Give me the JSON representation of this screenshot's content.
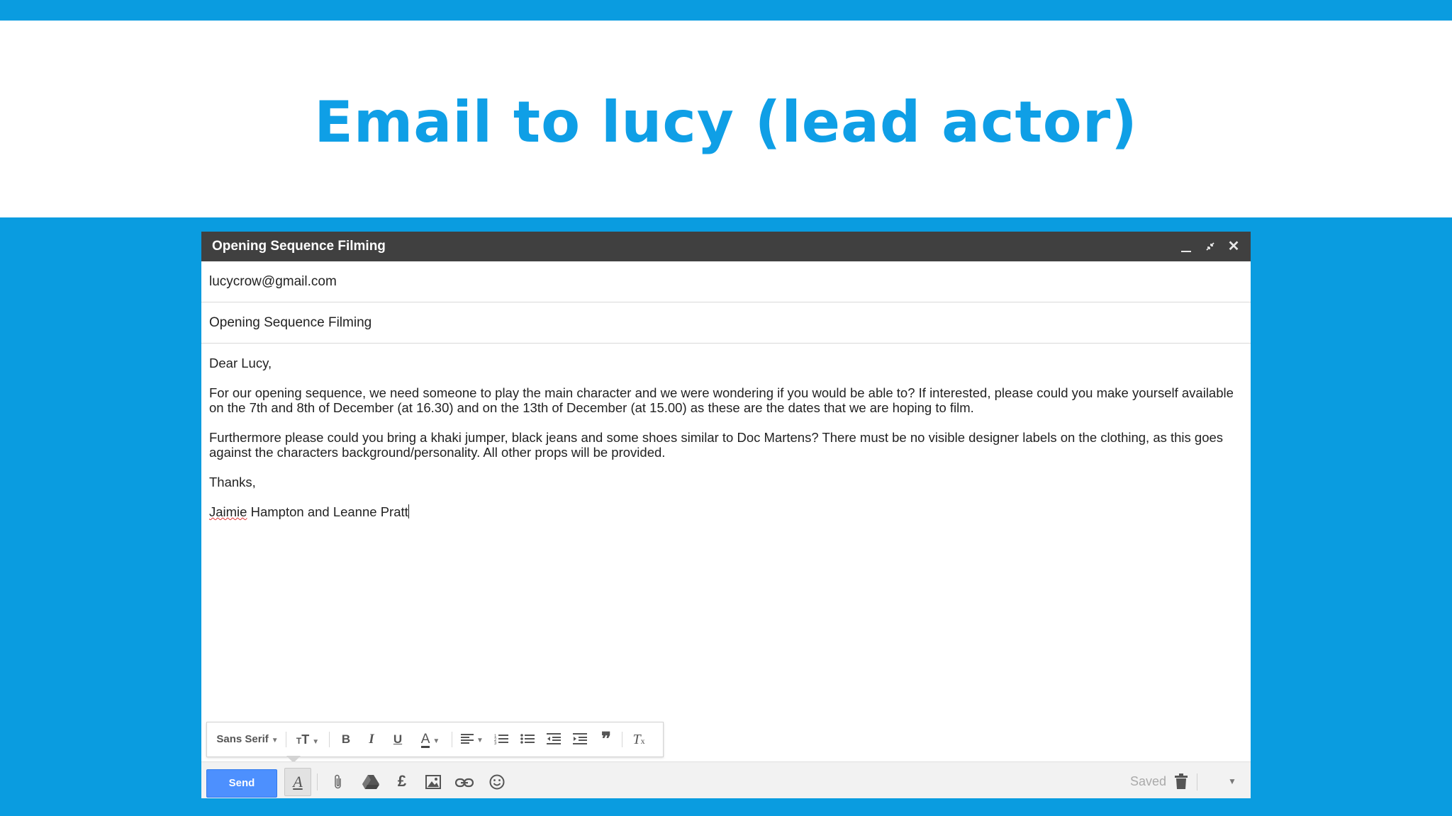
{
  "slide": {
    "title": "Email to lucy (lead actor)"
  },
  "compose": {
    "window_title": "Opening Sequence Filming",
    "to": "lucycrow@gmail.com",
    "subject": "Opening Sequence Filming",
    "body": {
      "greeting": "Dear Lucy,",
      "paragraph1": "For our opening sequence, we need someone to play the main character and we were wondering if you would be able to? If interested, please could you make yourself available on the 7th and 8th of December (at 16.30) and on the 13th of December (at 15.00) as these are the dates that we are hoping to film.",
      "paragraph2": "Furthermore please could you bring a khaki jumper, black jeans and some shoes similar to Doc Martens? There must be no visible designer labels on the clothing, as this goes against the characters background/personality. All other props will be provided.",
      "closing": "Thanks,",
      "signature_first": "Jaimie",
      "signature_rest": " Hampton and Leanne Pratt"
    },
    "format_bar": {
      "font": "Sans Serif"
    },
    "bottom": {
      "send_label": "Send",
      "status": "Saved"
    }
  },
  "colors": {
    "brand_blue": "#0a9ce0",
    "title_blue": "#0f9fe6",
    "send_blue": "#4d90fe",
    "header_dark": "#404040"
  },
  "icons": [
    "minimize-icon",
    "popout-icon",
    "close-icon",
    "text-size-icon",
    "bold-icon",
    "italic-icon",
    "underline-icon",
    "text-color-icon",
    "align-icon",
    "numbered-list-icon",
    "bulleted-list-icon",
    "indent-less-icon",
    "indent-more-icon",
    "quote-icon",
    "remove-formatting-icon",
    "formatting-options-icon",
    "attach-icon",
    "drive-icon",
    "money-icon",
    "photo-icon",
    "link-icon",
    "emoji-icon",
    "trash-icon",
    "more-options-icon"
  ]
}
